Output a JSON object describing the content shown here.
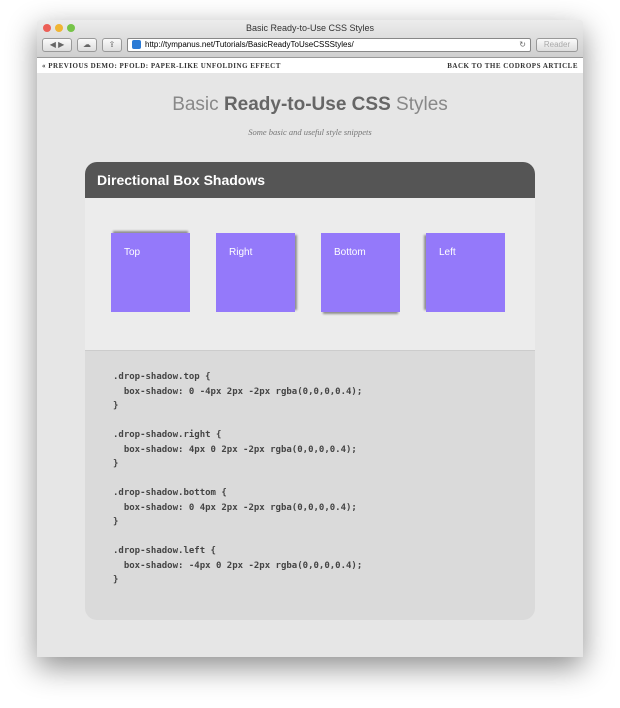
{
  "window": {
    "title": "Basic Ready-to-Use CSS Styles",
    "url": "http://tympanus.net/Tutorials/BasicReadyToUseCSSStyles/",
    "reader": "Reader"
  },
  "nav": {
    "previous": "« PREVIOUS DEMO: PFOLD: PAPER-LIKE UNFOLDING EFFECT",
    "back": "BACK TO THE CODROPS ARTICLE"
  },
  "header": {
    "title_pre": "Basic ",
    "title_bold": "Ready-to-Use CSS",
    "title_post": " Styles",
    "subtitle": "Some basic and useful style snippets"
  },
  "panel": {
    "title": "Directional Box Shadows",
    "boxes": [
      "Top",
      "Right",
      "Bottom",
      "Left"
    ],
    "box_color": "#9479fa",
    "code": ".drop-shadow.top {\n  box-shadow: 0 -4px 2px -2px rgba(0,0,0,0.4);\n}\n\n.drop-shadow.right {\n  box-shadow: 4px 0 2px -2px rgba(0,0,0,0.4);\n}\n\n.drop-shadow.bottom {\n  box-shadow: 0 4px 2px -2px rgba(0,0,0,0.4);\n}\n\n.drop-shadow.left {\n  box-shadow: -4px 0 2px -2px rgba(0,0,0,0.4);\n}"
  }
}
